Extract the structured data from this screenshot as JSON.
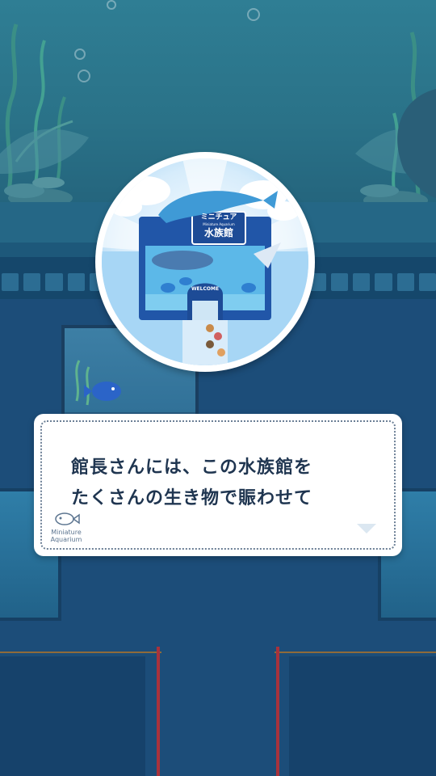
{
  "dialog": {
    "line1": "館長さんには、この水族館を",
    "line2": "たくさんの生き物で賑わせて"
  },
  "logo": {
    "sign_line1": "ミニチュア",
    "sign_line2": "水族館",
    "sign_small": "Miniature Aquarium",
    "welcome": "WELCOME",
    "dialog_logo_line1": "Miniature",
    "dialog_logo_line2": "Aquarium"
  },
  "colors": {
    "water_top": "#2f7e94",
    "floor": "#1c4d79",
    "dialog_text": "#1f3550",
    "building": "#2156a8"
  },
  "icons": [
    "fish-icon",
    "dolphin-icon",
    "next-arrow-icon"
  ]
}
